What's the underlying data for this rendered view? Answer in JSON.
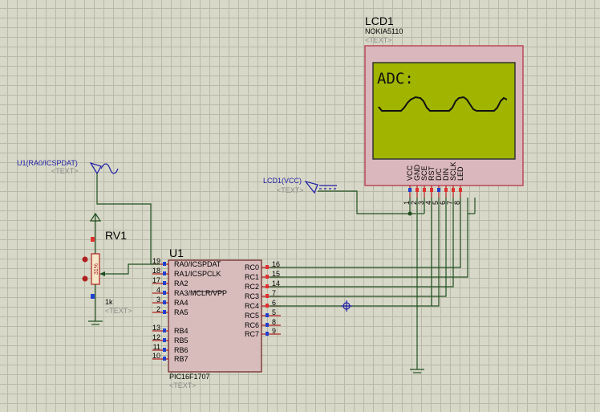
{
  "lcd": {
    "ref": "LCD1",
    "model": "NOKIA5110",
    "text_placeholder": "<TEXT>",
    "screen_text": "ADC:",
    "pins": [
      {
        "num": "1",
        "name": "VCC"
      },
      {
        "num": "2",
        "name": "GND"
      },
      {
        "num": "3",
        "name": "SCE"
      },
      {
        "num": "4",
        "name": "RST"
      },
      {
        "num": "5",
        "name": "D/C"
      },
      {
        "num": "6",
        "name": "DIN"
      },
      {
        "num": "7",
        "name": "SCLK"
      },
      {
        "num": "8",
        "name": "LED"
      }
    ],
    "colors": {
      "screen": "#a0b400",
      "frame": "#d9b7bd",
      "frame_border": "#b84a55"
    }
  },
  "probe_ra0": {
    "label": "U1(RA0/ICSPDAT)",
    "text_placeholder": "<TEXT>"
  },
  "probe_vcc": {
    "label": "LCD1(VCC)",
    "text_placeholder": "<TEXT>"
  },
  "rv1": {
    "ref": "RV1",
    "value": "1k",
    "text_placeholder": "<TEXT>",
    "wiper_percent": "31%"
  },
  "u1": {
    "ref": "U1",
    "part": "PIC16F1707",
    "text_placeholder": "<TEXT>",
    "left_pins": [
      {
        "num": "19",
        "name": "RA0/ICSPDAT"
      },
      {
        "num": "18",
        "name": "RA1/ICSPCLK"
      },
      {
        "num": "17",
        "name": "RA2"
      },
      {
        "num": "4",
        "name": "RA3/MCLR/VPP"
      },
      {
        "num": "3",
        "name": "RA4"
      },
      {
        "num": "2",
        "name": "RA5"
      },
      {
        "num": "13",
        "name": "RB4"
      },
      {
        "num": "12",
        "name": "RB5"
      },
      {
        "num": "11",
        "name": "RB6"
      },
      {
        "num": "10",
        "name": "RB7"
      }
    ],
    "right_pins": [
      {
        "num": "16",
        "name": "RC0"
      },
      {
        "num": "15",
        "name": "RC1"
      },
      {
        "num": "14",
        "name": "RC2"
      },
      {
        "num": "7",
        "name": "RC3"
      },
      {
        "num": "6",
        "name": "RC4"
      },
      {
        "num": "5",
        "name": "RC5"
      },
      {
        "num": "8",
        "name": "RC6"
      },
      {
        "num": "9",
        "name": "RC7"
      }
    ],
    "colors": {
      "body": "#d8bcbc",
      "border": "#6b2020"
    }
  },
  "colors": {
    "wire": "#1f4f1f",
    "probe_label": "#1f1fa8",
    "placeholder": "#8a8a8a"
  }
}
